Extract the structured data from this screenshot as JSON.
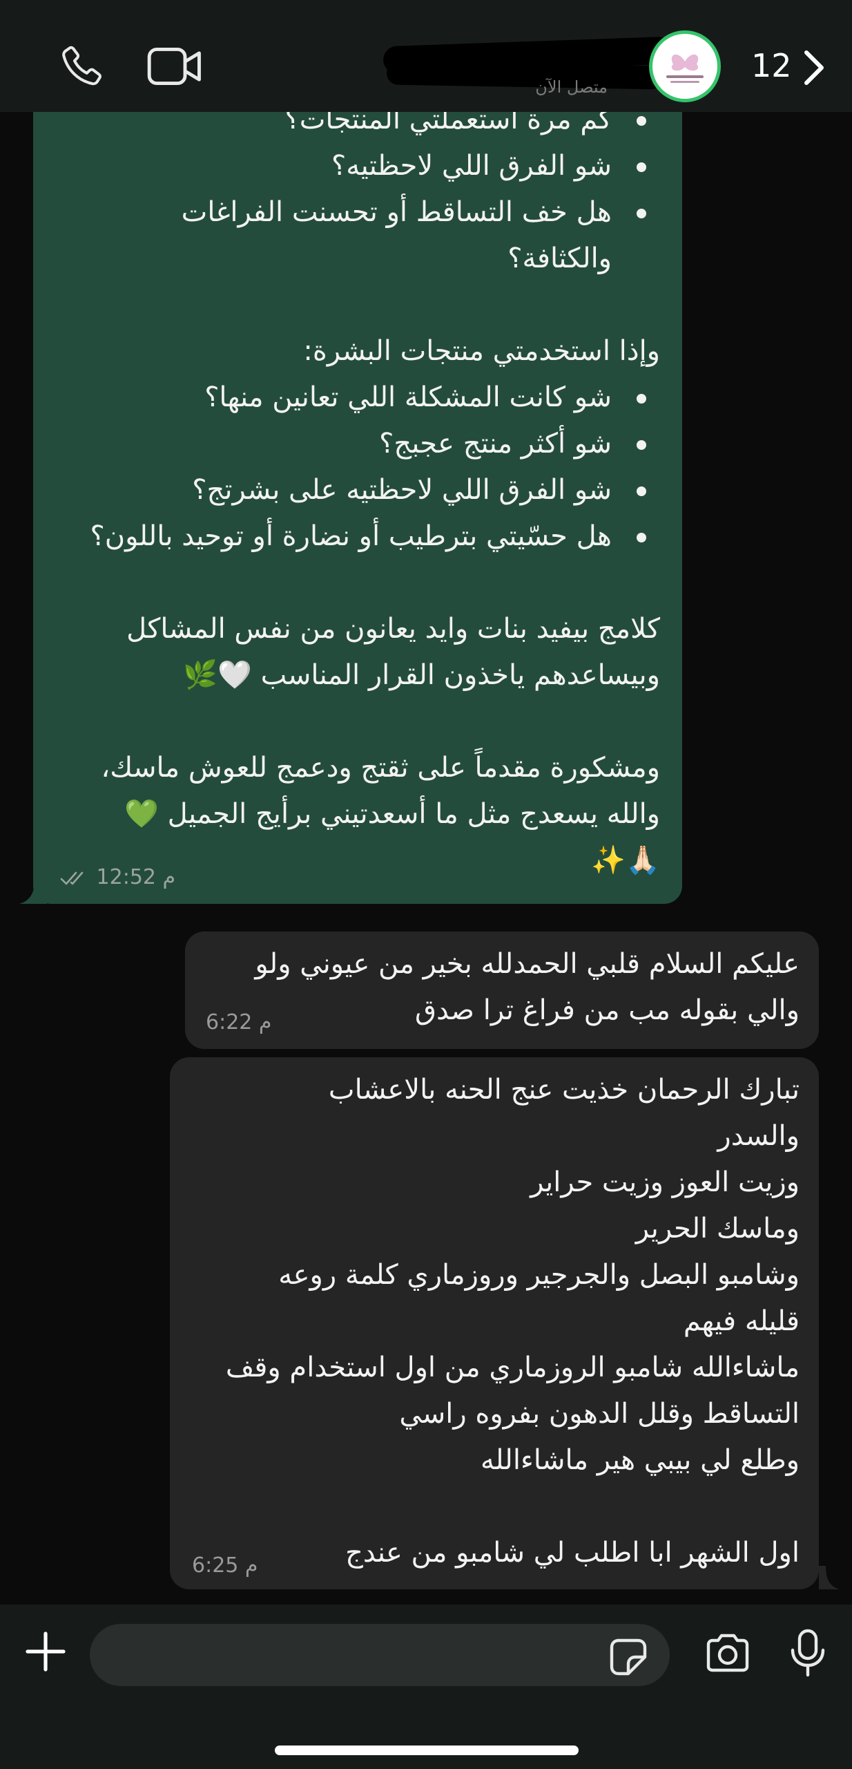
{
  "header": {
    "status": "متصل الآن",
    "unread_count": "12",
    "icons": [
      "phone-icon",
      "video-icon",
      "chevron-right-icon"
    ]
  },
  "outgoing_message": {
    "partial_top_line": "كم مرة استعملتي المنتجات؟",
    "hair_bullets": [
      "شو الفرق اللي لاحظتيه؟",
      "هل خف التساقط أو تحسنت الفراغات",
      "والكثافة؟"
    ],
    "skin_heading": "وإذا استخدمتي منتجات البشرة:",
    "skin_bullets": [
      "شو كانت المشكلة اللي تعانين منها؟",
      "شو أكثر منتج عجبج؟",
      "شو الفرق اللي لاحظتيه على بشرتج؟",
      "هل حسّيتي بترطيب أو نضارة أو توحيد باللون؟"
    ],
    "paragraph1": [
      "كلامج بيفيد بنات وايد يعانون من نفس المشاكل",
      "وبيساعدهم ياخذون القرار المناسب 🤍🌿"
    ],
    "paragraph2": [
      "ومشكورة مقدماً على ثقتج ودعمج للعوش ماسك،",
      "والله يسعدج مثل ما أسعدتيني برأيج الجميل 💚",
      "🙏🏻✨"
    ],
    "time": "12:52 م"
  },
  "incoming_message_1": {
    "lines": [
      "عليكم السلام قلبي الحمدلله بخير من عيوني ولو",
      "والي بقوله مب من فراغ ترا صدق"
    ],
    "time": "6:22 م"
  },
  "incoming_message_2": {
    "lines": [
      "تبارك الرحمان خذيت عنج الحنه بالاعشاب",
      "والسدر",
      "وزيت العوز وزيت حراير",
      "وماسك الحرير",
      "وشامبو البصل والجرجير وروزماري كلمة روعه",
      "قليله فيهم",
      "ماشاءالله شامبو الروزماري من اول استخدام وقف",
      "التساقط وقلل الدهون بفروه راسي",
      "وطلع لي بيبي هير ماشاءالله"
    ],
    "last_line": "اول الشهر ابا اطلب لي شامبو من عندج",
    "time": "6:25 م"
  },
  "composer": {
    "input_value": "",
    "icons": [
      "plus-icon",
      "sticker-icon",
      "camera-icon",
      "microphone-icon"
    ]
  }
}
